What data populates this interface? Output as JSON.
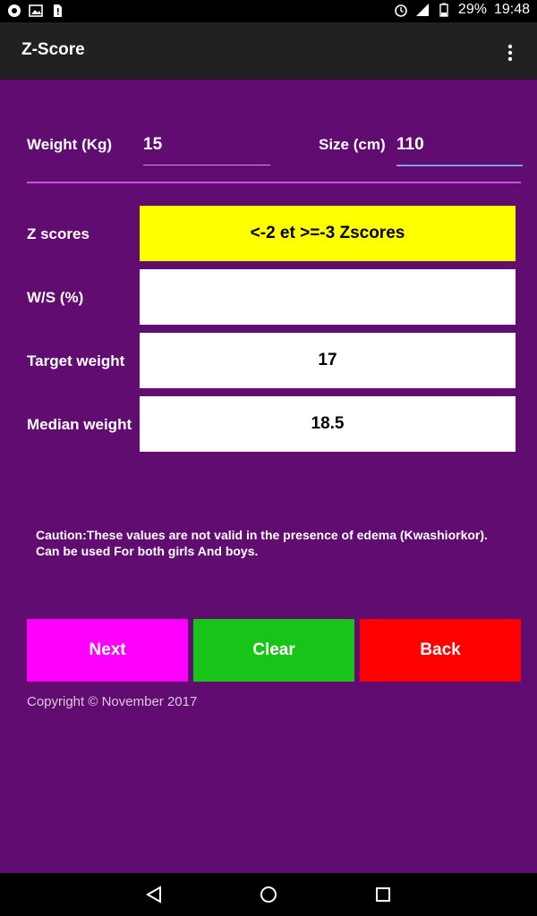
{
  "status_bar": {
    "battery_percent": "29%",
    "time": "19:48",
    "left_icons": [
      "record-icon",
      "image-icon",
      "sim-alert-icon"
    ],
    "right_icons": [
      "alarm-icon",
      "signal-icon",
      "battery-icon"
    ]
  },
  "toolbar": {
    "title": "Z-Score",
    "overflow_icon": "more-vertical-icon"
  },
  "inputs": {
    "weight": {
      "label": "Weight (Kg)",
      "value": "15"
    },
    "size": {
      "label": "Size (cm)",
      "value": "110"
    }
  },
  "results": [
    {
      "label": "Z scores",
      "value": "<-2 et >=-3 Zscores",
      "color": "#ffff00"
    },
    {
      "label": "W/S (%)",
      "value": ""
    },
    {
      "label": "Target weight",
      "value": "17"
    },
    {
      "label": "Median weight",
      "value": "18.5"
    }
  ],
  "caution": {
    "line1": "Caution:These values are not valid in the presence of edema (Kwashiorkor).",
    "line2": "Can be used For both girls And boys."
  },
  "buttons": {
    "next": {
      "label": "Next",
      "color": "#ff00ff"
    },
    "clear": {
      "label": "Clear",
      "color": "#19c419"
    },
    "back": {
      "label": "Back",
      "color": "#ff0000"
    }
  },
  "copyright": "Copyright © November 2017",
  "colors": {
    "background": "#600c70",
    "toolbar": "#212121",
    "divider": "#d14fe0"
  },
  "nav_bar": {
    "icons": [
      "back-triangle-icon",
      "home-circle-icon",
      "recents-square-icon"
    ]
  }
}
